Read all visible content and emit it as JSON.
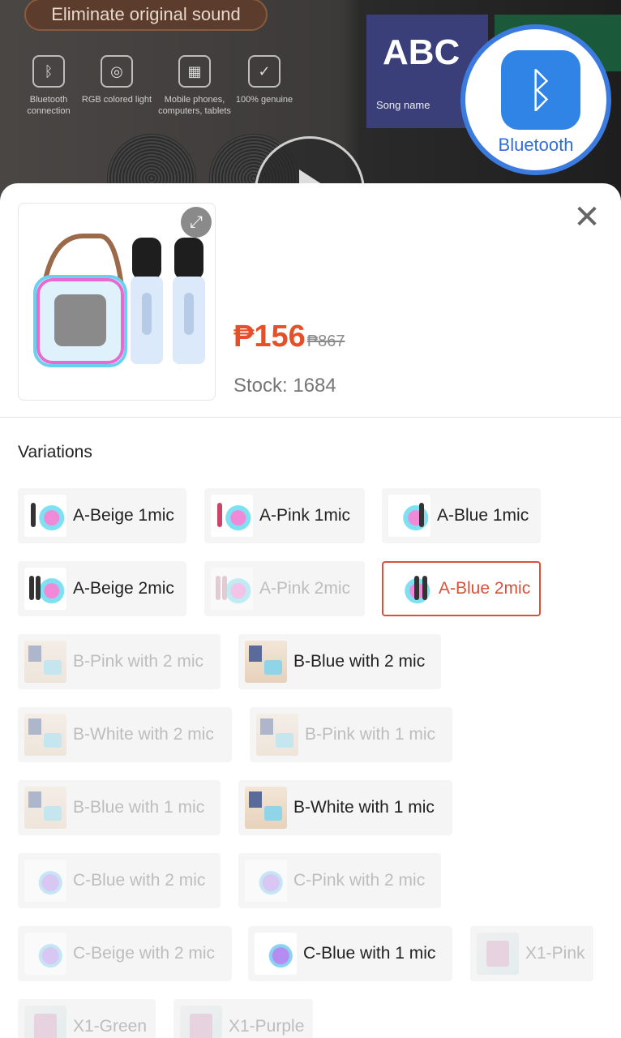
{
  "banner": {
    "headline": "Eliminate original sound",
    "features": [
      {
        "icon": "bluetooth-icon",
        "label": "Bluetooth connection"
      },
      {
        "icon": "rgb-light-icon",
        "label": "RGB colored light"
      },
      {
        "icon": "devices-icon",
        "label": "Mobile phones, computers, tablets"
      },
      {
        "icon": "shield-check-icon",
        "label": "100% genuine"
      }
    ],
    "screen_title": "ABC",
    "screen_subtitle": "Song name",
    "bluetooth_label": "Bluetooth"
  },
  "product": {
    "price": "₱156",
    "original_price": "₱867",
    "stock": "Stock: 1684",
    "expand_icon": "expand-icon",
    "close_icon": "close-icon"
  },
  "variations_title": "Variations",
  "variations": [
    {
      "label": "A-Beige 1mic",
      "state": "available",
      "thumb": "a"
    },
    {
      "label": "A-Pink 1mic",
      "state": "available",
      "thumb": "a"
    },
    {
      "label": "A-Blue 1mic",
      "state": "available",
      "thumb": "a"
    },
    {
      "label": "A-Beige 2mic",
      "state": "available",
      "thumb": "a"
    },
    {
      "label": "A-Pink 2mic",
      "state": "disabled",
      "thumb": "a"
    },
    {
      "label": "A-Blue 2mic",
      "state": "selected",
      "thumb": "a"
    },
    {
      "label": "B-Pink with 2 mic",
      "state": "disabled",
      "thumb": "b"
    },
    {
      "label": "B-Blue with 2 mic",
      "state": "available",
      "thumb": "b"
    },
    {
      "label": "B-White with 2 mic",
      "state": "disabled",
      "thumb": "b"
    },
    {
      "label": "B-Pink with 1 mic",
      "state": "disabled",
      "thumb": "b"
    },
    {
      "label": "B-Blue with 1 mic",
      "state": "disabled",
      "thumb": "b"
    },
    {
      "label": "B-White with 1 mic",
      "state": "available",
      "thumb": "b"
    },
    {
      "label": "C-Blue with 2 mic",
      "state": "disabled",
      "thumb": "c"
    },
    {
      "label": "C-Pink with 2 mic",
      "state": "disabled",
      "thumb": "c"
    },
    {
      "label": "C-Beige with 2 mic",
      "state": "disabled",
      "thumb": "c"
    },
    {
      "label": "C-Blue with 1 mic",
      "state": "available",
      "thumb": "c"
    },
    {
      "label": "X1-Pink",
      "state": "disabled",
      "thumb": "x"
    },
    {
      "label": "X1-Green",
      "state": "disabled",
      "thumb": "x"
    },
    {
      "label": "X1-Purple",
      "state": "disabled",
      "thumb": "x"
    }
  ],
  "colors": {
    "accent": "#e5502a",
    "selected_border": "#d4533a",
    "chip_bg": "#f5f5f5",
    "disabled_text": "#bdbdbd"
  }
}
